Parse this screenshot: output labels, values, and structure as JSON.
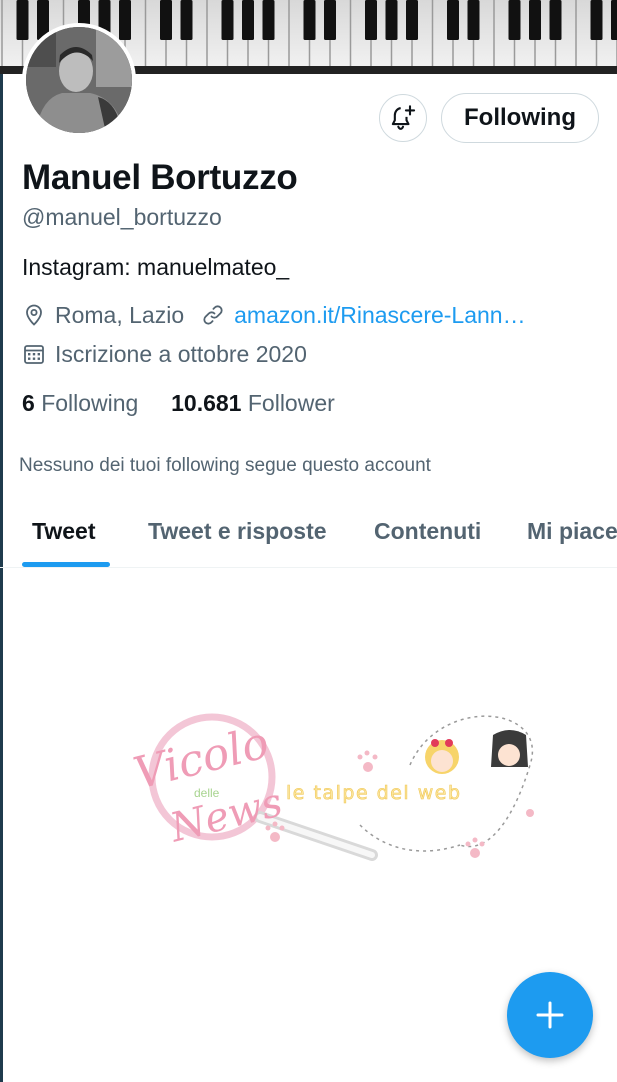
{
  "profile": {
    "name": "Manuel Bortuzzo",
    "handle": "@manuel_bortuzzo",
    "bio": "Instagram: manuelmateo_",
    "location": "Roma, Lazio",
    "website": "amazon.it/Rinascere-Lann…",
    "joined": "Iscrizione a ottobre 2020"
  },
  "actions": {
    "follow_label": "Following"
  },
  "stats": {
    "following_count": "6",
    "following_label": "Following",
    "followers_count": "10.681",
    "followers_label": "Follower"
  },
  "mutuals_note": "Nessuno dei tuoi following segue questo account",
  "tabs": [
    {
      "label": "Tweet",
      "active": true
    },
    {
      "label": "Tweet e risposte",
      "active": false
    },
    {
      "label": "Contenuti",
      "active": false
    },
    {
      "label": "Mi piace",
      "active": false
    }
  ],
  "watermark": {
    "logo_text_1": "Vicolo",
    "logo_text_2": "delle",
    "logo_text_3": "News",
    "tagline": "le talpe del web"
  },
  "icons": {
    "bell": "bell-plus-icon",
    "location": "location-pin-icon",
    "link": "link-icon",
    "calendar": "calendar-icon",
    "compose": "plus-icon"
  },
  "colors": {
    "accent": "#1d9bf0",
    "text_primary": "#0f1419",
    "text_secondary": "#536471"
  }
}
